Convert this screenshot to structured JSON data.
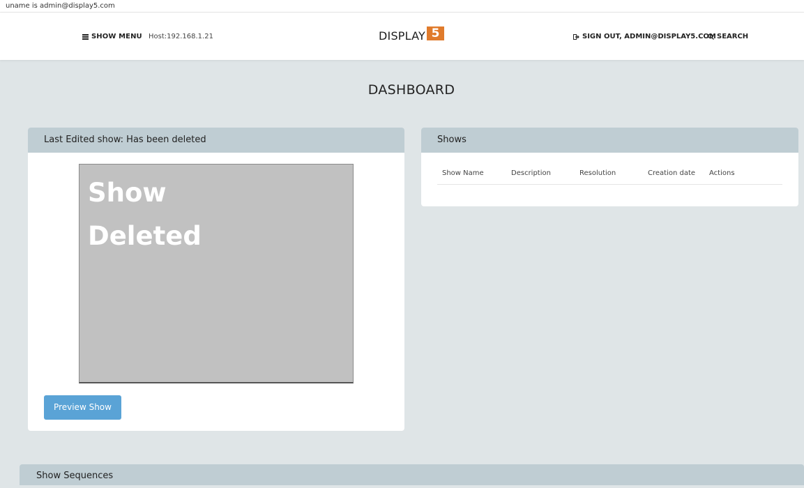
{
  "debug": {
    "uname_text": "uname is admin@display5.com"
  },
  "nav": {
    "menu_label": "SHOW MENU",
    "host": "Host:192.168.1.21",
    "logo_text": "DISPLAY",
    "logo_number": "5",
    "signout_label": "SIGN OUT, ADMIN@DISPLAY5.COM",
    "search_label": "SEARCH"
  },
  "page": {
    "title": "DASHBOARD"
  },
  "last_edited": {
    "header": "Last Edited show: Has been deleted",
    "preview_line1": "Show",
    "preview_line2": "Deleted",
    "preview_button": "Preview Show"
  },
  "shows": {
    "header": "Shows",
    "columns": [
      "Show Name",
      "Description",
      "Resolution",
      "Creation date",
      "Actions"
    ]
  },
  "sequences": {
    "header": "Show Sequences"
  },
  "colors": {
    "background": "#dfe5e7",
    "panel_header": "#bfcdd3",
    "logo_accent": "#e07b2c",
    "button": "#5aa3d6"
  }
}
